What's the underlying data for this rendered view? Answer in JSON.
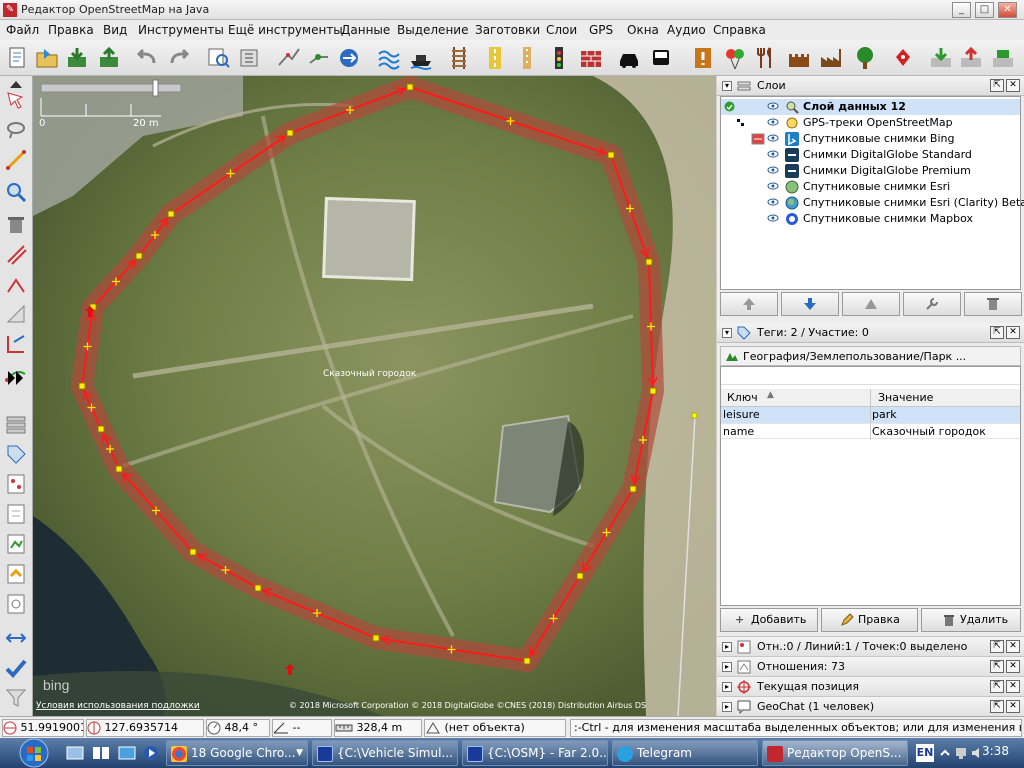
{
  "window": {
    "title": "Редактор OpenStreetMap на Java",
    "minimize": "_",
    "maximize": "□",
    "close": "✕"
  },
  "menu": [
    "Файл",
    "Правка",
    "Вид",
    "Инструменты",
    "Ещё инструменты",
    "Данные",
    "Выделение",
    "Заготовки",
    "Слои",
    "GPS",
    "Окна",
    "Аудио",
    "Справка"
  ],
  "map": {
    "scale_left": "0",
    "scale_right": "20 m",
    "place_label": "Сказочный городок",
    "provider": "bing",
    "terms_link": "Условия использования подложки",
    "copyright": "© 2018 Microsoft Corporation © 2018 DigitalGlobe ©CNES (2018) Distribution Airbus DS"
  },
  "layers": {
    "title": "Слои",
    "items": [
      {
        "name": "Слой данных 12",
        "active": true
      },
      {
        "name": "GPS-треки OpenStreetMap"
      },
      {
        "name": "Спутниковые снимки Bing"
      },
      {
        "name": "Снимки DigitalGlobe Standard"
      },
      {
        "name": "Снимки DigitalGlobe Premium"
      },
      {
        "name": "Спутниковые снимки Esri"
      },
      {
        "name": "Спутниковые снимки Esri (Clarity) Beta"
      },
      {
        "name": "Спутниковые снимки Mapbox"
      }
    ]
  },
  "tags": {
    "title": "Теги: 2 / Участие: 0",
    "preset": "География/Землепользование/Парк ...",
    "col_key": "Ключ",
    "col_value": "Значение",
    "rows": [
      {
        "key": "leisure",
        "value": "park"
      },
      {
        "key": "name",
        "value": "Сказочный городок"
      }
    ],
    "add": "Добавить",
    "edit": "Правка",
    "delete": "Удалить"
  },
  "docks": [
    "Отн.:0 / Линий:1 / Точек:0 выделено",
    "Отношения: 73",
    "Текущая позиция",
    "GeoChat (1 человек)"
  ],
  "status": {
    "lat": "51.9919001",
    "lon": "127.6935714",
    "angle": "48,4 °",
    "heading": "--",
    "length": "328,4 m",
    "object": "(нет объекта)",
    "hint": ":-Ctrl - для изменения масштаба выделенных объектов; или для изменения выделения"
  },
  "taskbar": {
    "items": [
      "18 Google Chro...",
      "{C:\\Vehicle Simul...",
      "{C:\\OSM} - Far 2.0...",
      "Telegram",
      "Редактор OpenS..."
    ],
    "lang": "EN",
    "clock": "3:38"
  },
  "colors": {
    "way": "#ff1a1a",
    "way_highlight": "#b04a3a",
    "node": "#ffee00",
    "active_layer_bg": "#cfe2f8"
  }
}
